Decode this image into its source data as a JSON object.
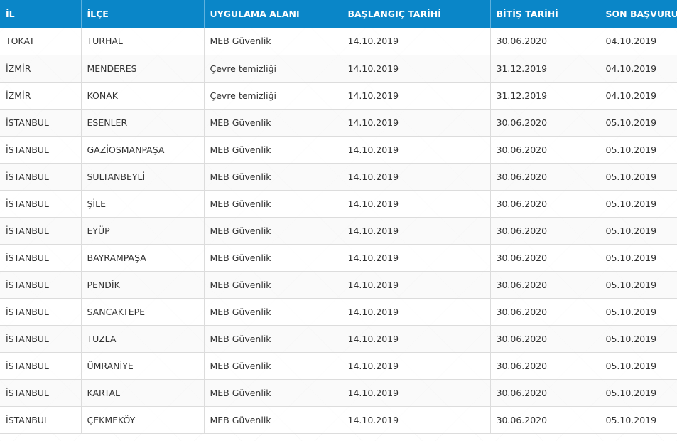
{
  "table": {
    "headers": [
      "İL",
      "İLÇE",
      "UYGULAMA ALANI",
      "BAŞLANGIÇ TARİHİ",
      "BİTİŞ TARİHİ",
      "SON BAŞVURU"
    ],
    "rows": [
      [
        "TOKAT",
        "TURHAL",
        "MEB Güvenlik",
        "14.10.2019",
        "30.06.2020",
        "04.10.2019"
      ],
      [
        "İZMİR",
        "MENDERES",
        "Çevre temizliği",
        "14.10.2019",
        "31.12.2019",
        "04.10.2019"
      ],
      [
        "İZMİR",
        "KONAK",
        "Çevre temizliği",
        "14.10.2019",
        "31.12.2019",
        "04.10.2019"
      ],
      [
        "İSTANBUL",
        "ESENLER",
        "MEB Güvenlik",
        "14.10.2019",
        "30.06.2020",
        "05.10.2019"
      ],
      [
        "İSTANBUL",
        "GAZİOSMANPAŞA",
        "MEB Güvenlik",
        "14.10.2019",
        "30.06.2020",
        "05.10.2019"
      ],
      [
        "İSTANBUL",
        "SULTANBEYLİ",
        "MEB Güvenlik",
        "14.10.2019",
        "30.06.2020",
        "05.10.2019"
      ],
      [
        "İSTANBUL",
        "ŞİLE",
        "MEB Güvenlik",
        "14.10.2019",
        "30.06.2020",
        "05.10.2019"
      ],
      [
        "İSTANBUL",
        "EYÜP",
        "MEB Güvenlik",
        "14.10.2019",
        "30.06.2020",
        "05.10.2019"
      ],
      [
        "İSTANBUL",
        "BAYRAMPAŞA",
        "MEB Güvenlik",
        "14.10.2019",
        "30.06.2020",
        "05.10.2019"
      ],
      [
        "İSTANBUL",
        "PENDİK",
        "MEB Güvenlik",
        "14.10.2019",
        "30.06.2020",
        "05.10.2019"
      ],
      [
        "İSTANBUL",
        "SANCAKTEPE",
        "MEB Güvenlik",
        "14.10.2019",
        "30.06.2020",
        "05.10.2019"
      ],
      [
        "İSTANBUL",
        "TUZLA",
        "MEB Güvenlik",
        "14.10.2019",
        "30.06.2020",
        "05.10.2019"
      ],
      [
        "İSTANBUL",
        "ÜMRANİYE",
        "MEB Güvenlik",
        "14.10.2019",
        "30.06.2020",
        "05.10.2019"
      ],
      [
        "İSTANBUL",
        "KARTAL",
        "MEB Güvenlik",
        "14.10.2019",
        "30.06.2020",
        "05.10.2019"
      ],
      [
        "İSTANBUL",
        "ÇEKMEKÖY",
        "MEB Güvenlik",
        "14.10.2019",
        "30.06.2020",
        "05.10.2019"
      ]
    ]
  },
  "colors": {
    "header_bg": "#0a86c8",
    "header_text": "#ffffff",
    "cell_text": "#333333",
    "border": "#dcdcdc"
  }
}
